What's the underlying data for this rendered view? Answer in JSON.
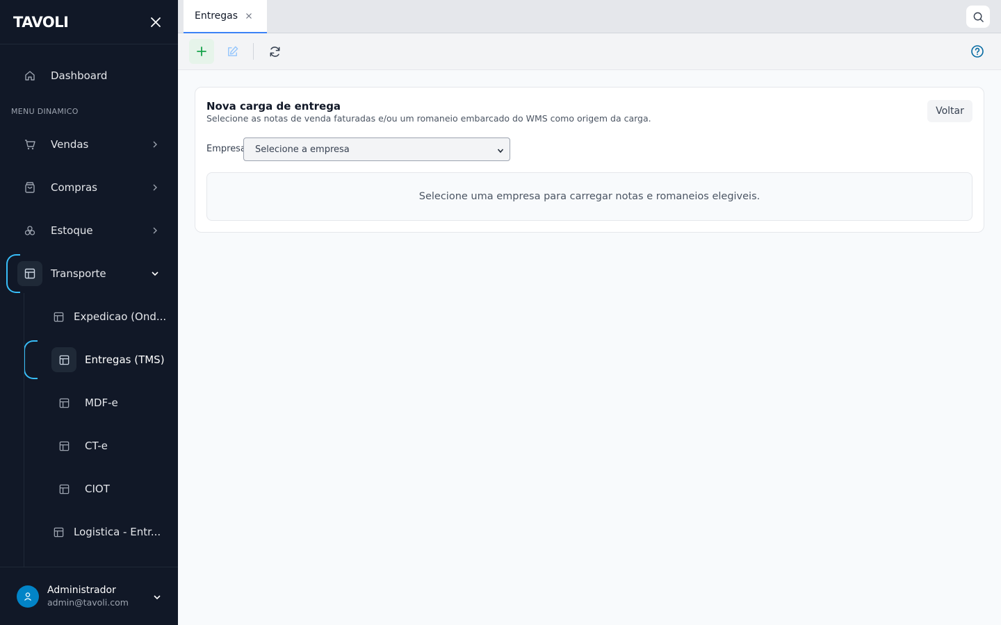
{
  "app": {
    "logo": "TAVOLI"
  },
  "sidebar": {
    "section_label": "MENU DINAMICO",
    "dashboard": {
      "label": "Dashboard",
      "icon": "home-icon"
    },
    "items": [
      {
        "label": "Vendas",
        "icon": "cart-icon",
        "expanded": false
      },
      {
        "label": "Compras",
        "icon": "bag-icon",
        "expanded": false
      },
      {
        "label": "Estoque",
        "icon": "boxes-icon",
        "expanded": false
      },
      {
        "label": "Transporte",
        "icon": "layout-icon",
        "expanded": true
      }
    ],
    "subitems": [
      {
        "label": "Expedicao (Ond..."
      },
      {
        "label": "Entregas (TMS)",
        "active": true
      },
      {
        "label": "MDF-e"
      },
      {
        "label": "CT-e"
      },
      {
        "label": "CIOT"
      },
      {
        "label": "Logistica - Entr..."
      }
    ],
    "user": {
      "name": "Administrador",
      "email": "admin@tavoli.com"
    }
  },
  "tabs": [
    {
      "label": "Entregas",
      "active": true
    }
  ],
  "toolbar": {
    "add": "plus-icon",
    "edit": "edit-icon",
    "refresh": "refresh-icon",
    "help": "help-icon"
  },
  "card": {
    "title": "Nova carga de entrega",
    "subtitle": "Selecione as notas de venda faturadas e/ou um romaneio embarcado do WMS como origem da carga.",
    "back_label": "Voltar",
    "empresa_label": "Empresa",
    "empresa_select_value": "Selecione a empresa",
    "empty_message": "Selecione uma empresa para carregar notas e romaneios elegiveis."
  },
  "colors": {
    "sidebar_bg": "#111827",
    "accent": "#38bdf8",
    "tab_accent": "#3b82f6",
    "add_green": "#16a34a",
    "help_blue": "#0369a1"
  }
}
